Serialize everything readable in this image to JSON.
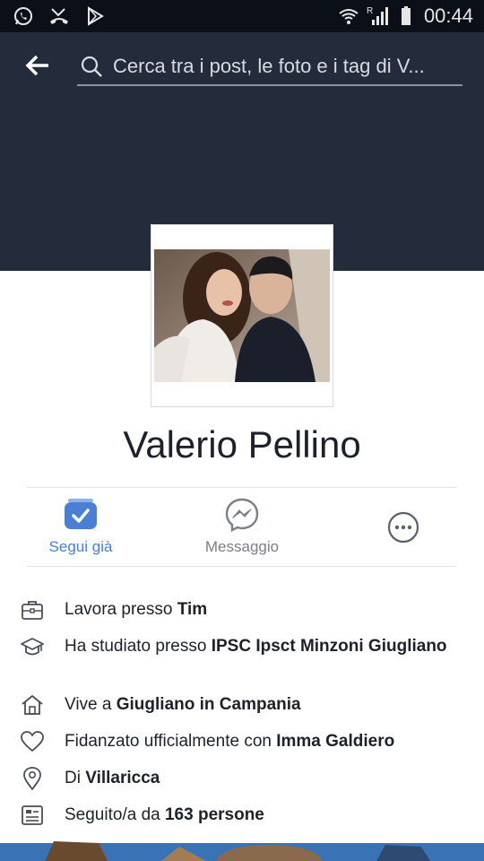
{
  "status_bar": {
    "time": "00:44",
    "left_icons": [
      "whatsapp-icon",
      "missed-call-icon",
      "play-store-icon"
    ],
    "right_icons": [
      "wifi-icon",
      "roaming-signal-icon",
      "battery-icon"
    ],
    "roaming_letter": "R"
  },
  "header": {
    "search_placeholder": "Cerca tra i post, le foto e i tag di V..."
  },
  "profile": {
    "name": "Valerio Pellino"
  },
  "actions": [
    {
      "label": "Segui già",
      "icon": "following-check-icon",
      "active": true
    },
    {
      "label": "Messaggio",
      "icon": "messenger-icon",
      "active": false
    },
    {
      "label": "",
      "icon": "more-options-icon",
      "active": false
    }
  ],
  "about": {
    "work": {
      "prefix": "Lavora presso ",
      "value": "Tim"
    },
    "education": {
      "prefix": "Ha studiato presso ",
      "value": "IPSC Ipsct Minzoni Giugliano"
    },
    "lives": {
      "prefix": "Vive a ",
      "value": "Giugliano in Campania"
    },
    "relationship": {
      "prefix": "Fidanzato ufficialmente con ",
      "value": "Imma Galdiero"
    },
    "from": {
      "prefix": "Di ",
      "value": "Villaricca"
    },
    "followers": {
      "prefix": "Seguito/a da ",
      "value": "163 persone"
    }
  },
  "colors": {
    "cover": "#242b3a",
    "accent": "#4b7fd6",
    "text": "#1d2129",
    "muted": "#7b7f86"
  }
}
